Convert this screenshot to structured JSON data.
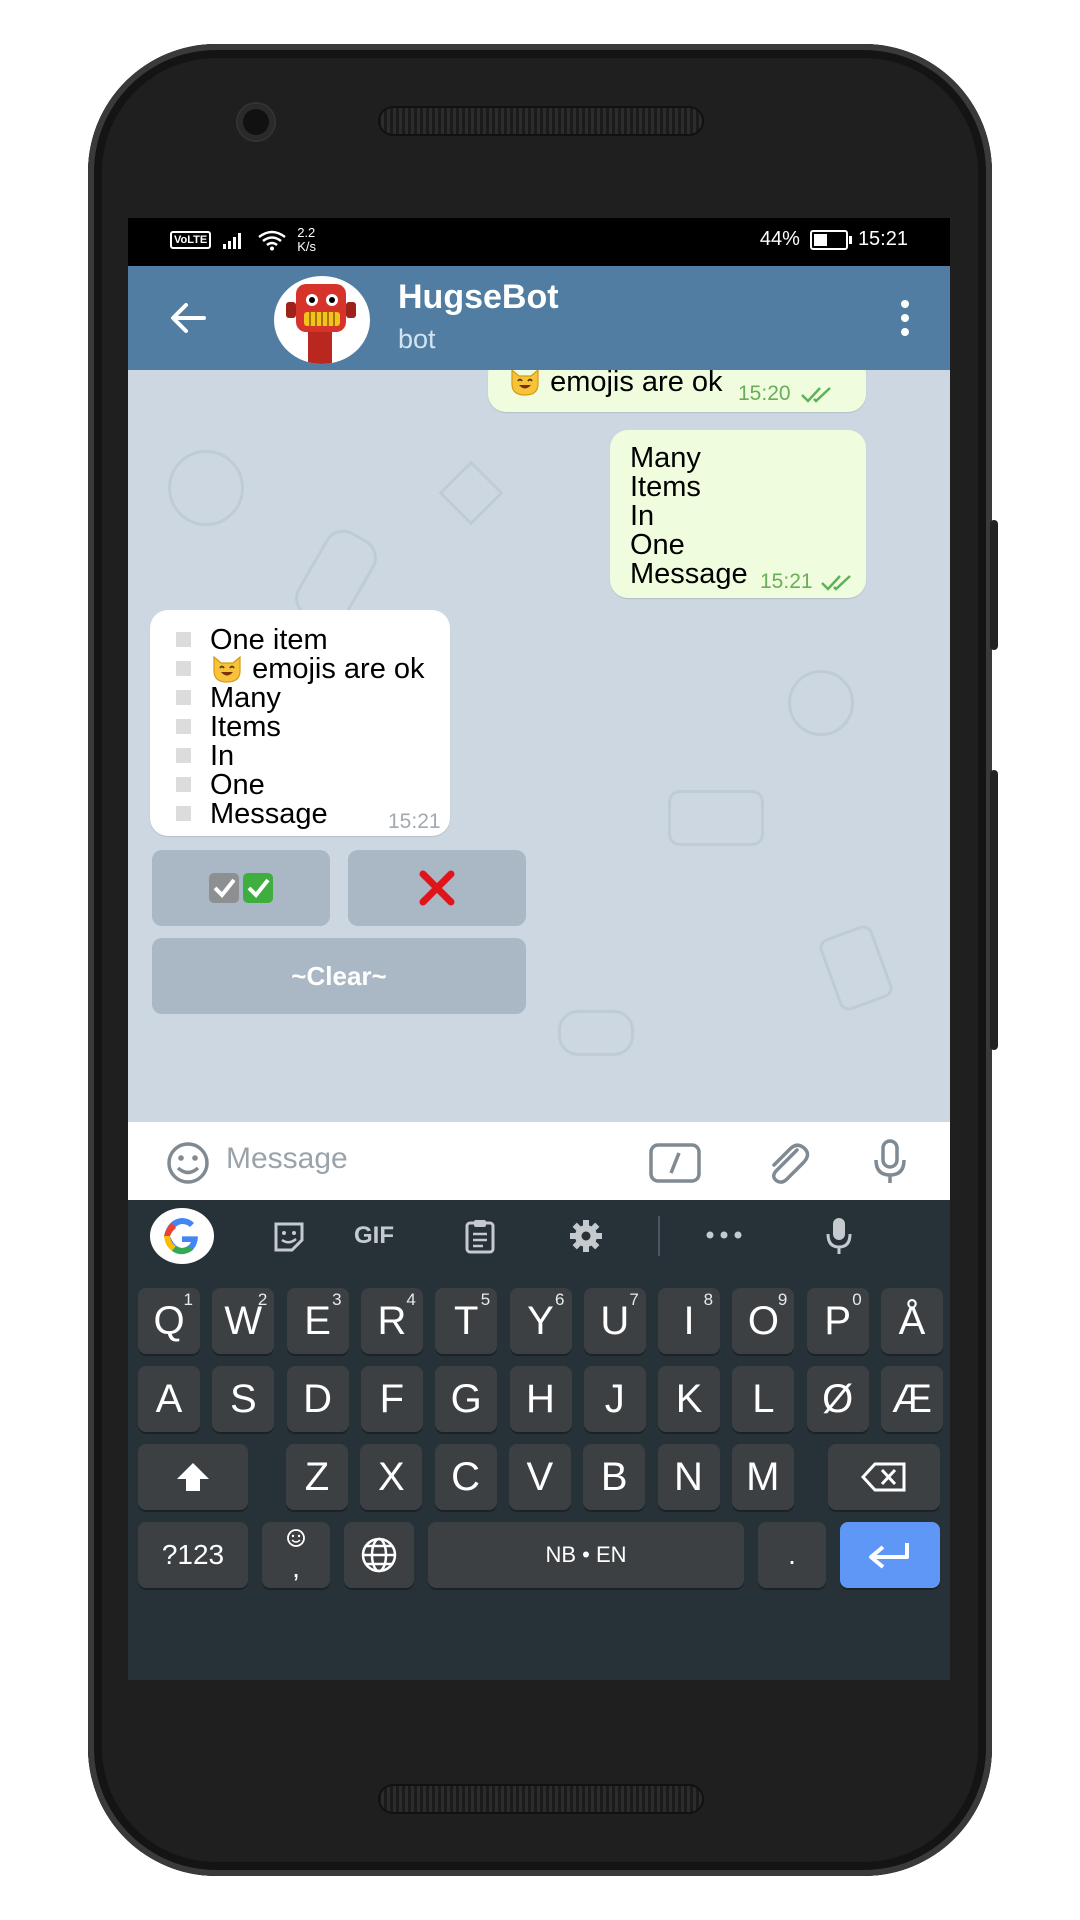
{
  "status": {
    "network_badge": "VoLTE",
    "net_speed_value": "2.2",
    "net_speed_unit": "K/s",
    "battery_pct": "44%",
    "battery_level": 0.44,
    "time": "15:21"
  },
  "header": {
    "title": "HugseBot",
    "subtitle": "bot"
  },
  "messages": {
    "out1": {
      "text": "emojis are ok",
      "time": "15:20"
    },
    "out2": {
      "lines": [
        "Many",
        "Items",
        "In",
        "One",
        "Message"
      ],
      "time": "15:21"
    },
    "in1": {
      "items": [
        "One item",
        "emojis are ok",
        "Many",
        "Items",
        "In",
        "One",
        "Message"
      ],
      "time": "15:21"
    }
  },
  "inline_keyboard": {
    "clear_label": "~Clear~"
  },
  "composer": {
    "placeholder": "Message"
  },
  "keyboard": {
    "tools": [
      "google-icon",
      "sticker-icon",
      "gif",
      "clipboard-icon",
      "settings-icon",
      "more-icon",
      "mic-icon"
    ],
    "gif_label": "GIF",
    "row1": [
      {
        "k": "Q",
        "h": "1"
      },
      {
        "k": "W",
        "h": "2"
      },
      {
        "k": "E",
        "h": "3"
      },
      {
        "k": "R",
        "h": "4"
      },
      {
        "k": "T",
        "h": "5"
      },
      {
        "k": "Y",
        "h": "6"
      },
      {
        "k": "U",
        "h": "7"
      },
      {
        "k": "I",
        "h": "8"
      },
      {
        "k": "O",
        "h": "9"
      },
      {
        "k": "P",
        "h": "0"
      },
      {
        "k": "Å",
        "h": ""
      }
    ],
    "row2": [
      "A",
      "S",
      "D",
      "F",
      "G",
      "H",
      "J",
      "K",
      "L",
      "Ø",
      "Æ"
    ],
    "row3": [
      "Z",
      "X",
      "C",
      "V",
      "B",
      "N",
      "M"
    ],
    "sym_label": "?123",
    "comma_label": ",",
    "space_label": "NB • EN",
    "period_label": "."
  },
  "colors": {
    "header": "#517da2",
    "outgoing": "#effdde",
    "enter": "#5e97f6",
    "keyboard": "#263238"
  }
}
